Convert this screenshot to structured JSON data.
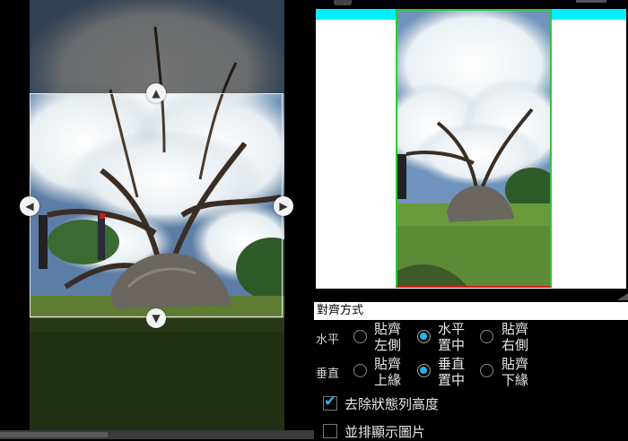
{
  "crop_editor": {
    "handles": [
      "chevron-up-icon",
      "chevron-down-icon",
      "chevron-left-icon",
      "chevron-right-icon"
    ]
  },
  "settings": {
    "section_title": "對齊方式",
    "horizontal": {
      "label": "水平",
      "options": [
        {
          "line1": "貼齊",
          "line2": "左側",
          "checked": false
        },
        {
          "line1": "水平",
          "line2": "置中",
          "checked": true
        },
        {
          "line1": "貼齊",
          "line2": "右側",
          "checked": false
        }
      ]
    },
    "vertical": {
      "label": "垂直",
      "options": [
        {
          "line1": "貼齊",
          "line2": "上緣",
          "checked": false
        },
        {
          "line1": "垂直",
          "line2": "置中",
          "checked": true
        },
        {
          "line1": "貼齊",
          "line2": "下緣",
          "checked": false
        }
      ]
    },
    "checkboxes": [
      {
        "label": "去除狀態列高度",
        "checked": true
      },
      {
        "label": "並排顯示圖片",
        "checked": false
      }
    ]
  },
  "colors": {
    "accent": "#27b4e6",
    "cyan_bar": "#00f0ff",
    "frame_green": "#2ec83a",
    "frame_red": "#d42020"
  }
}
